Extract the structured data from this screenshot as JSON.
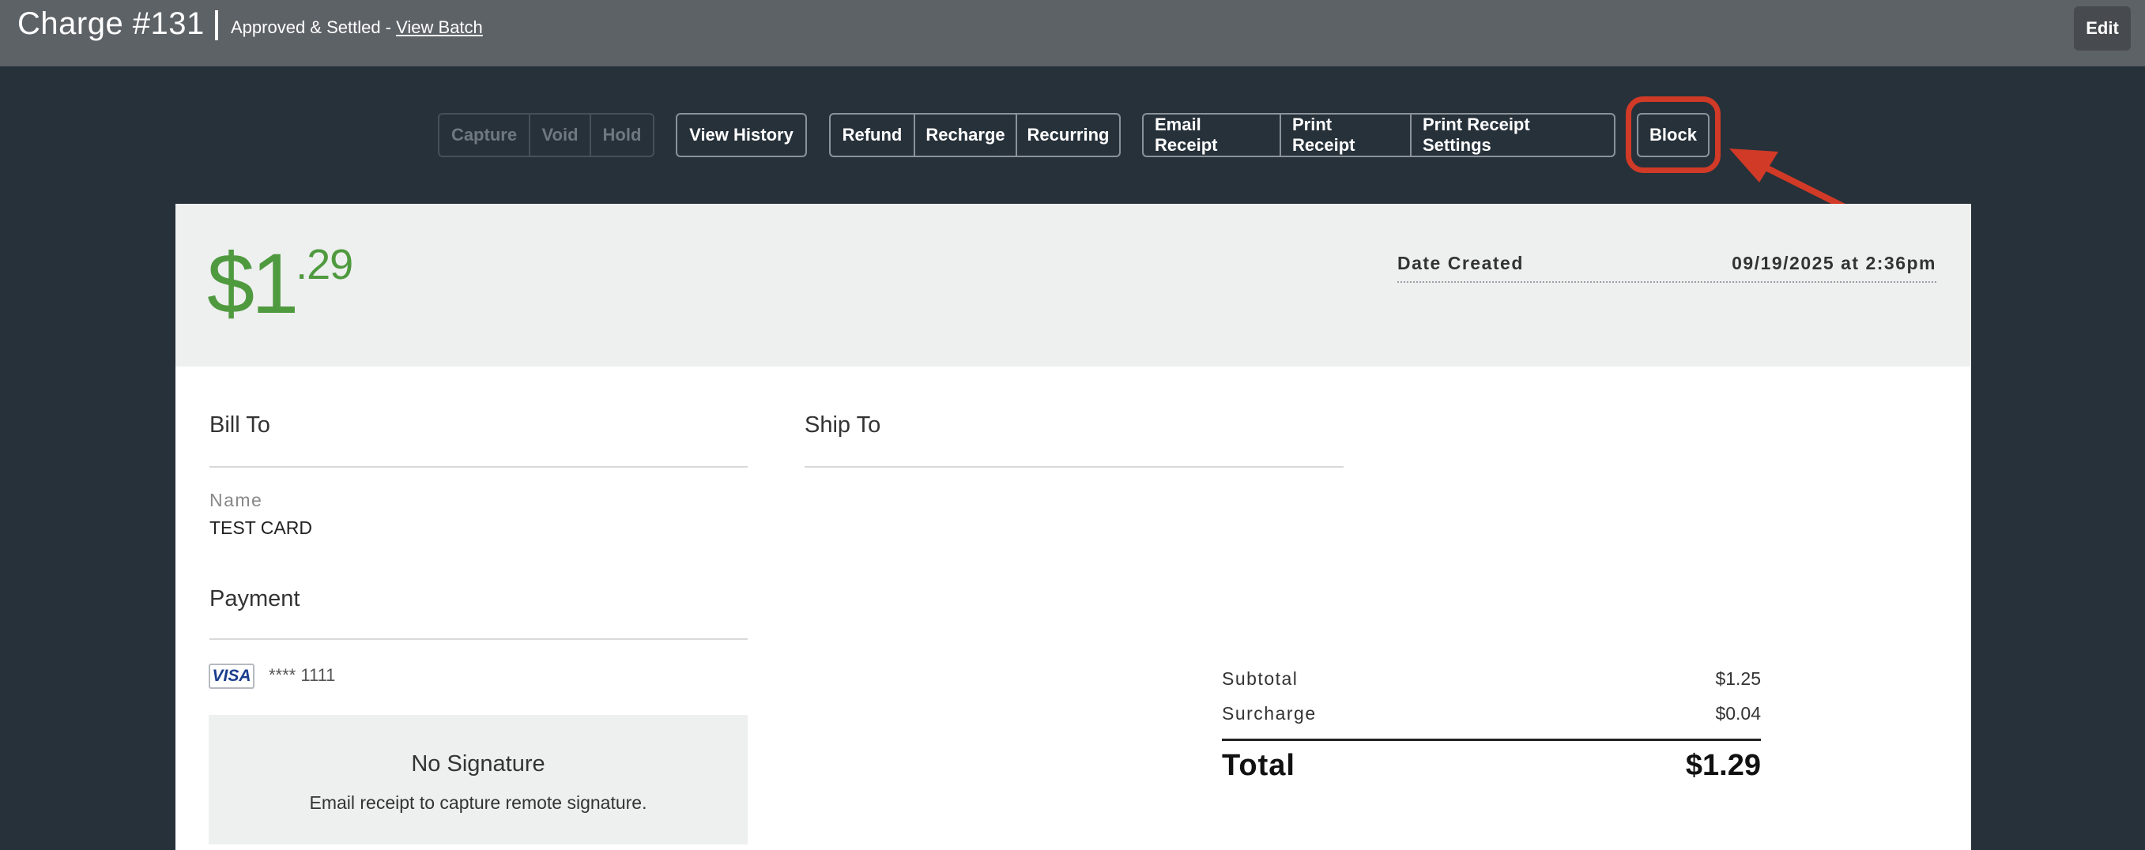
{
  "header": {
    "title": "Charge #131",
    "status": "Approved & Settled - ",
    "batch_link": "View Batch",
    "edit_label": "Edit"
  },
  "toolbar": {
    "capture": "Capture",
    "void": "Void",
    "hold": "Hold",
    "view_history": "View History",
    "refund": "Refund",
    "recharge": "Recharge",
    "recurring": "Recurring",
    "email_receipt": "Email Receipt",
    "print_receipt": "Print Receipt",
    "print_receipt_settings": "Print Receipt Settings",
    "block": "Block"
  },
  "summary": {
    "amount_whole": "$1",
    "amount_cents": ".29",
    "date_label": "Date Created",
    "date_value": "09/19/2025 at 2:36pm"
  },
  "bill_to": {
    "title": "Bill To",
    "name_label": "Name",
    "name_value": "TEST CARD"
  },
  "ship_to": {
    "title": "Ship To"
  },
  "payment": {
    "title": "Payment",
    "card_brand": "VISA",
    "card_number": "**** 1111",
    "signature_title": "No Signature",
    "signature_sub": "Email receipt to capture remote signature."
  },
  "totals": {
    "subtotal_label": "Subtotal",
    "subtotal_value": "$1.25",
    "surcharge_label": "Surcharge",
    "surcharge_value": "$0.04",
    "total_label": "Total",
    "total_value": "$1.29"
  },
  "colors": {
    "accent_green": "#4f9a3f",
    "annotation_red": "#d03a26"
  }
}
